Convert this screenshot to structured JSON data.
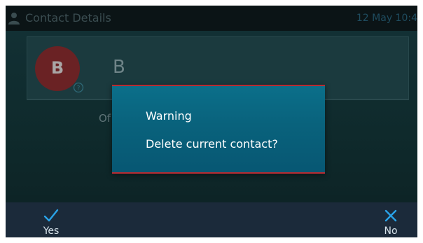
{
  "header": {
    "title": "Contact Details",
    "date": "12 May 10:4",
    "icon": "person-icon"
  },
  "contact": {
    "avatar_initial": "B",
    "name_partial": "B",
    "presence_icon": "presence-unknown-icon",
    "status_partial": "Of"
  },
  "dialog": {
    "title": "Warning",
    "message": "Delete current contact?",
    "accent_color": "#b82b32",
    "background_color": "#09627c"
  },
  "softkeys": {
    "yes": {
      "label": "Yes",
      "icon": "check-icon",
      "color": "#2aa3e8"
    },
    "no": {
      "label": "No",
      "icon": "close-icon",
      "color": "#2aa3e8"
    }
  }
}
